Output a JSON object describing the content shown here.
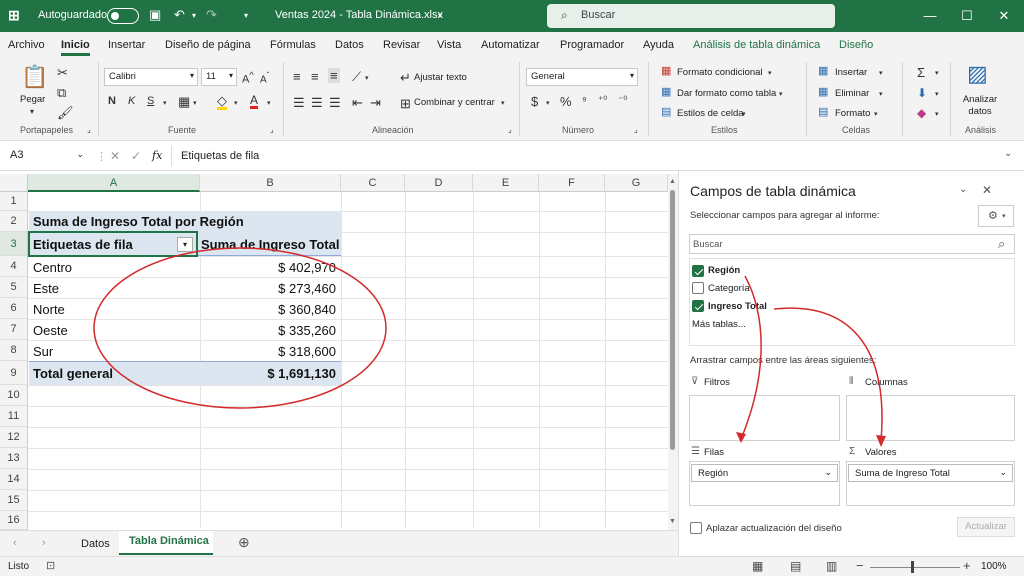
{
  "titlebar": {
    "autosave_label": "Autoguardado",
    "file_title": "Ventas 2024 - Tabla Dinámica.xlsx",
    "search_placeholder": "Buscar"
  },
  "menu": {
    "tabs": [
      "Archivo",
      "Inicio",
      "Insertar",
      "Diseño de página",
      "Fórmulas",
      "Datos",
      "Revisar",
      "Vista",
      "Automatizar",
      "Programador",
      "Ayuda",
      "Análisis de tabla dinámica",
      "Diseño"
    ],
    "active": "Inicio"
  },
  "ribbon": {
    "clipboard": {
      "paste": "Pegar",
      "label": "Portapapeles"
    },
    "font": {
      "name": "Calibri",
      "size": "11",
      "bold": "N",
      "italic": "K",
      "underline": "S",
      "label": "Fuente"
    },
    "alignment": {
      "wrap": "Ajustar texto",
      "merge": "Combinar y centrar",
      "label": "Alineación"
    },
    "number": {
      "format": "General",
      "currency": "$",
      "percent": "%",
      "label": "Número"
    },
    "styles": {
      "conditional": "Formato condicional",
      "as_table": "Dar formato como tabla",
      "cell_styles": "Estilos de celda",
      "label": "Estilos"
    },
    "cells": {
      "insert": "Insertar",
      "delete": "Eliminar",
      "format": "Formato",
      "label": "Celdas"
    },
    "analysis": {
      "analyze": "Analizar datos",
      "label": "Análisis"
    }
  },
  "formula_bar": {
    "name_box": "A3",
    "fx": "fx",
    "content": "Etiquetas de fila"
  },
  "grid": {
    "columns": [
      "A",
      "B",
      "C",
      "D",
      "E",
      "F",
      "G"
    ],
    "rows": [
      "1",
      "2",
      "3",
      "4",
      "5",
      "6",
      "7",
      "8",
      "9",
      "10",
      "11",
      "12",
      "13",
      "14",
      "15",
      "16"
    ],
    "pivot_title": "Suma de Ingreso Total por Región",
    "header_row_labels": "Etiquetas de fila",
    "header_values": "Suma de Ingreso Total",
    "data": [
      {
        "region": "Centro",
        "value": "$ 402,970"
      },
      {
        "region": "Este",
        "value": "$ 273,460"
      },
      {
        "region": "Norte",
        "value": "$ 360,840"
      },
      {
        "region": "Oeste",
        "value": "$ 335,260"
      },
      {
        "region": "Sur",
        "value": "$ 318,600"
      }
    ],
    "total_label": "Total general",
    "total_value": "$ 1,691,130"
  },
  "sheets": {
    "tabs": [
      "Datos",
      "Tabla Dinámica"
    ],
    "active": "Tabla Dinámica"
  },
  "status": {
    "ready": "Listo",
    "zoom": "100%"
  },
  "pivot_pane": {
    "title": "Campos de tabla dinámica",
    "subtitle": "Seleccionar campos para agregar al informe:",
    "search_placeholder": "Buscar",
    "fields": [
      {
        "name": "Región",
        "checked": true
      },
      {
        "name": "Categoría",
        "checked": false
      },
      {
        "name": "Ingreso Total",
        "checked": true
      }
    ],
    "more_tables": "Más tablas...",
    "drag_hint": "Arrastrar campos entre las áreas siguientes:",
    "filters_label": "Filtros",
    "columns_label": "Columnas",
    "rows_label": "Filas",
    "values_label": "Valores",
    "rows_field": "Región",
    "values_field": "Suma de Ingreso Total",
    "defer_label": "Aplazar actualización del diseño",
    "update_button": "Actualizar"
  },
  "colors": {
    "excel_green": "#217346",
    "pivot_header": "#dce6f1",
    "annotation_red": "#d42a2a"
  }
}
